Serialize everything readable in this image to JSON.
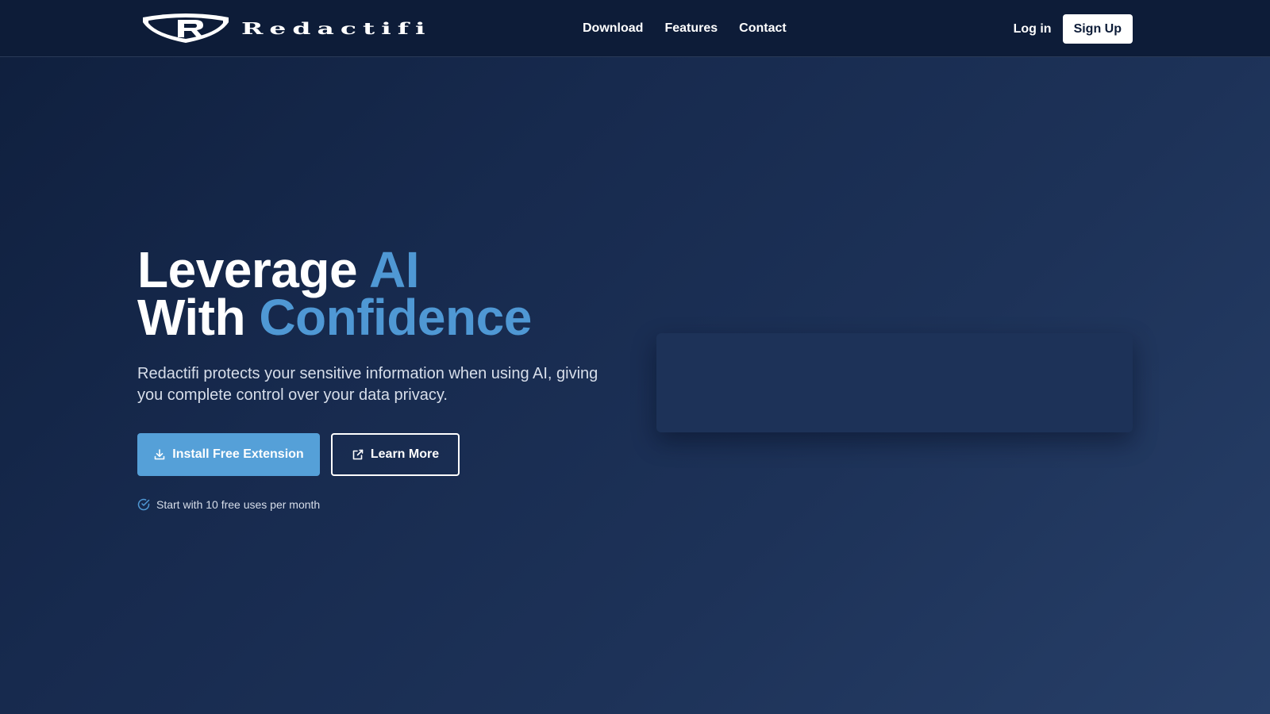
{
  "nav": {
    "brand": "Redactifi",
    "links": [
      "Download",
      "Features",
      "Contact"
    ],
    "login": "Log in",
    "signup": "Sign Up"
  },
  "hero": {
    "headline_line1_plain": "Leverage ",
    "headline_line1_accent": "AI",
    "headline_line2_plain": "With ",
    "headline_line2_accent": "Confidence",
    "subtext": "Redactifi protects your sensitive information when using AI, giving you complete control over your data privacy.",
    "primary_button": "Install Free Extension",
    "secondary_button": "Learn More",
    "note": "Start with 10 free uses per month"
  },
  "icons": {
    "logo": "shield-r-logo",
    "primary_button": "download-icon",
    "secondary_button": "external-link-icon",
    "note": "check-circle-icon"
  },
  "colors": {
    "accent": "#4f98d4",
    "primary_button": "#55a0d8",
    "navbar": "#0d1c38",
    "background": "#172a4e"
  }
}
